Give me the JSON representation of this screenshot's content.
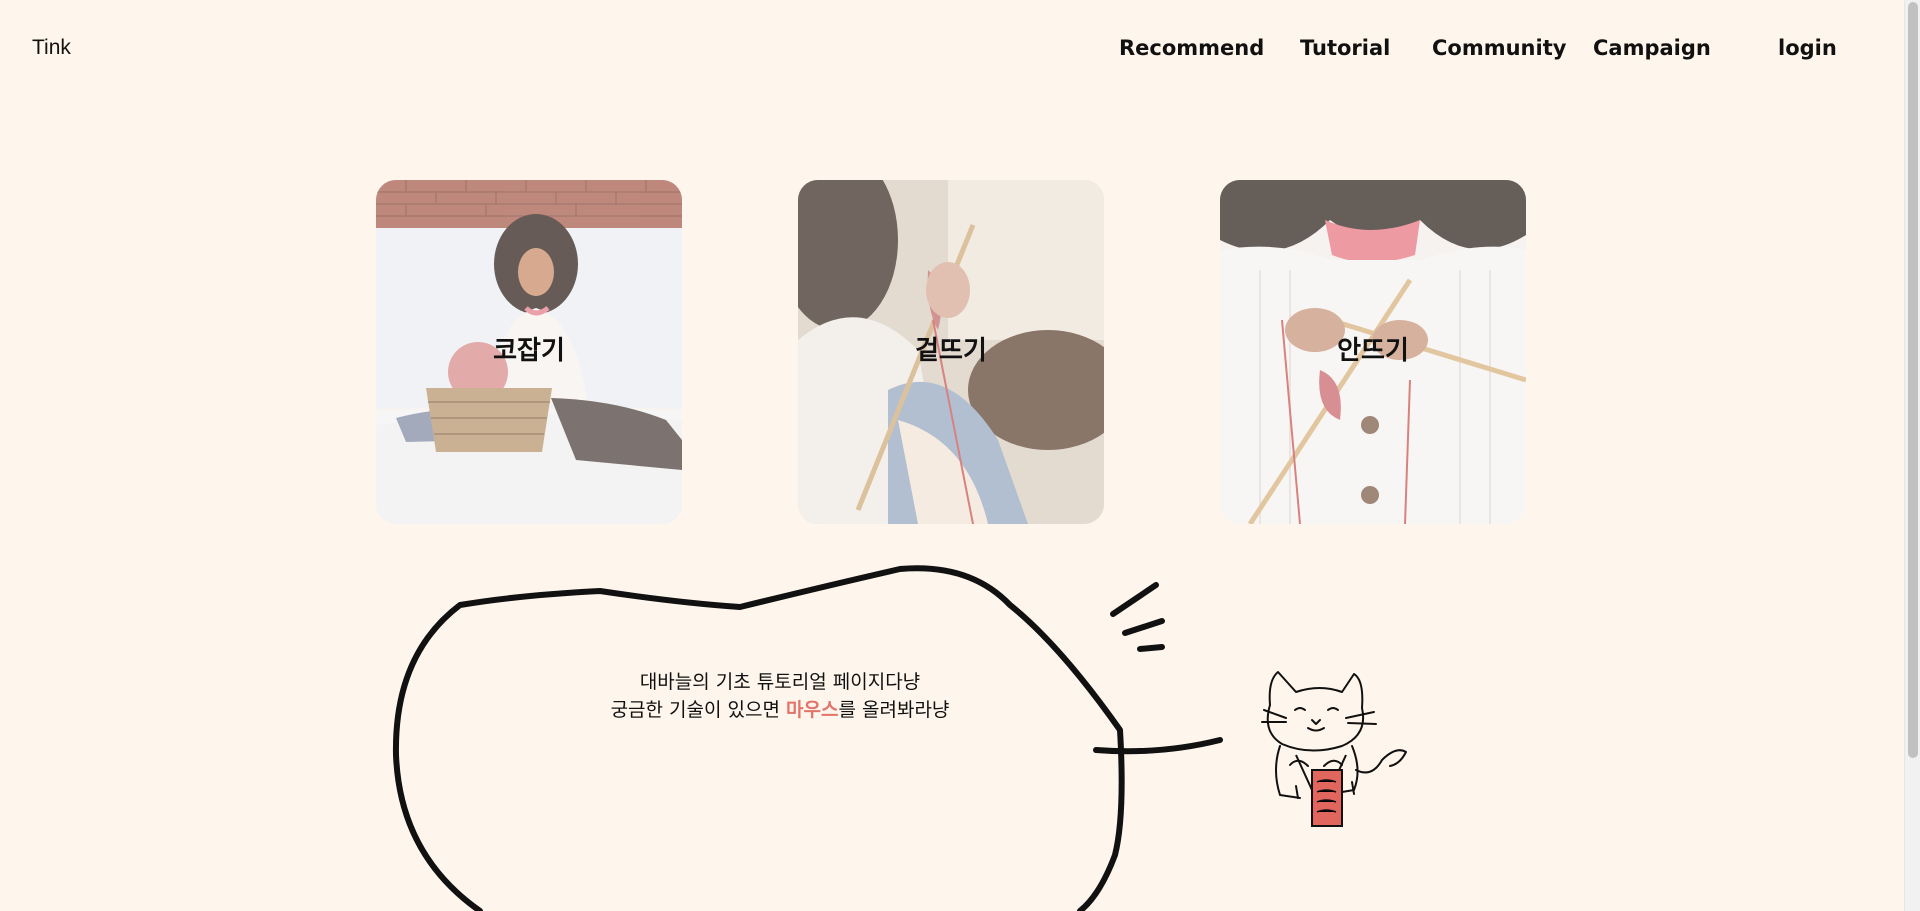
{
  "header": {
    "logo": "Tink",
    "nav": [
      {
        "label": "Recommend"
      },
      {
        "label": "Tutorial"
      },
      {
        "label": "Community"
      },
      {
        "label": "Campaign"
      },
      {
        "label": "login"
      }
    ]
  },
  "cards": [
    {
      "label": "코잡기"
    },
    {
      "label": "겉뜨기"
    },
    {
      "label": "안뜨기"
    }
  ],
  "bubble": {
    "line1": "대바늘의 기초 튜토리얼 페이지다냥",
    "line2_before": "궁금한 기술이 있으면 ",
    "line2_highlight": "마우스",
    "line2_after": "를 올려봐라냥"
  },
  "colors": {
    "background": "#fef6ec",
    "highlight": "#e2746a"
  }
}
